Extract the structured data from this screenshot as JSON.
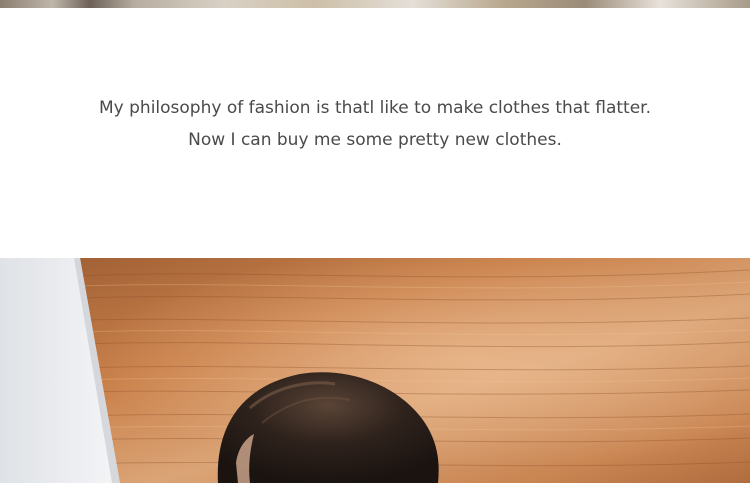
{
  "quote": {
    "line1": "My philosophy of fashion is thatl like to make clothes that flatter.",
    "line2": "Now I can buy me some pretty new clothes."
  },
  "colors": {
    "text": "#4a4a4a",
    "wood_light": "#d89a66",
    "wood_dark": "#9a5a30",
    "wall": "#e9ebee",
    "hair": "#2a1f1a"
  }
}
